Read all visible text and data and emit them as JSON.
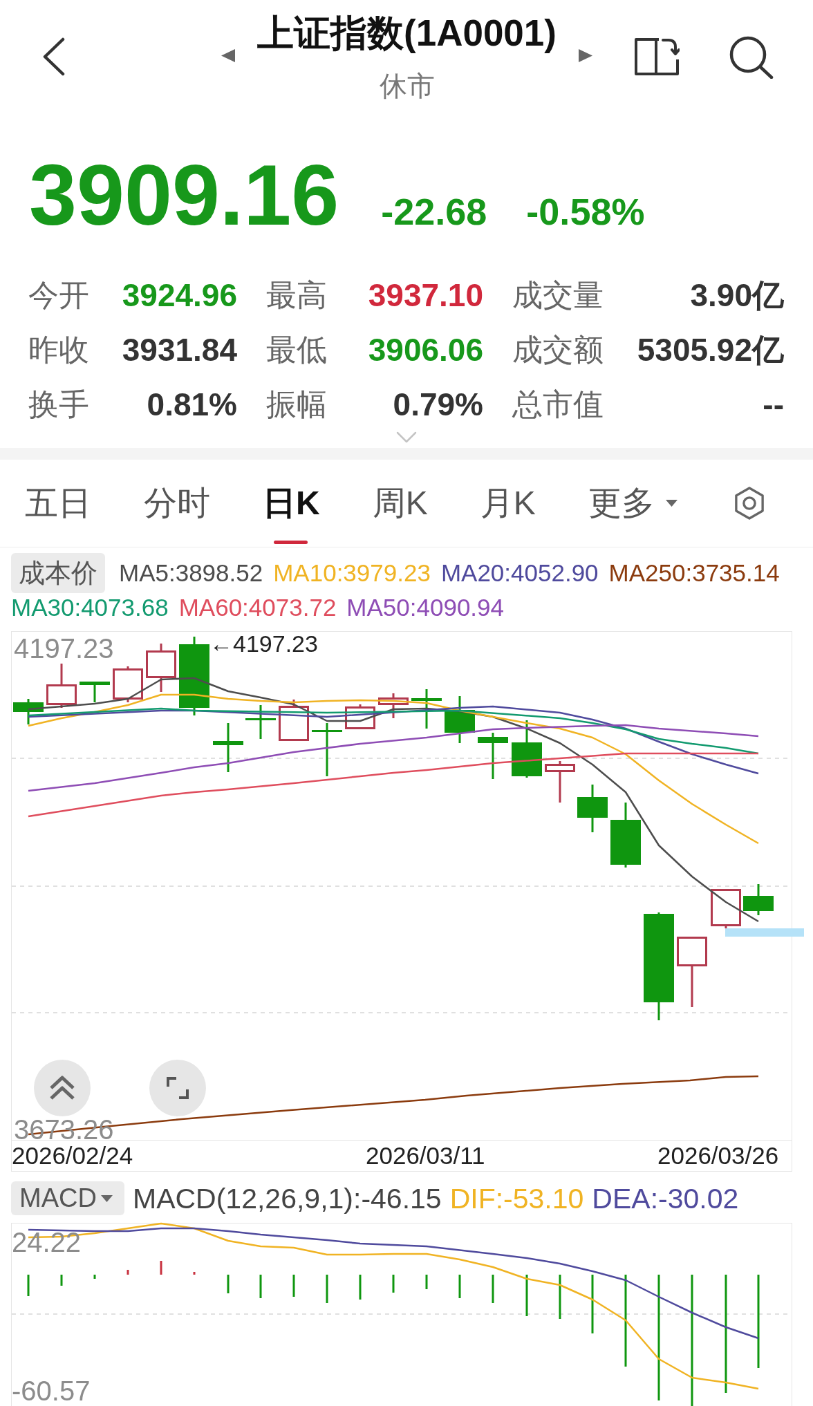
{
  "header": {
    "title": "上证指数(1A0001)",
    "status": "休市"
  },
  "quote": {
    "price": "3909.16",
    "change": "-22.68",
    "change_percent": "-0.58%",
    "rising": false
  },
  "stats": [
    {
      "label": "今开",
      "value": "3924.96",
      "color": "#17981b"
    },
    {
      "label": "最高",
      "value": "3937.10",
      "color": "#d1283c"
    },
    {
      "label": "成交量",
      "value": "3.90亿",
      "color": "#333333"
    },
    {
      "label": "昨收",
      "value": "3931.84",
      "color": "#333333"
    },
    {
      "label": "最低",
      "value": "3906.06",
      "color": "#17981b"
    },
    {
      "label": "成交额",
      "value": "5305.92亿",
      "color": "#333333"
    },
    {
      "label": "换手",
      "value": "0.81%",
      "color": "#333333"
    },
    {
      "label": "振幅",
      "value": "0.79%",
      "color": "#333333"
    },
    {
      "label": "总市值",
      "value": "--",
      "color": "#333333"
    }
  ],
  "tabs": [
    {
      "label": "五日",
      "kind": "period",
      "selected": false
    },
    {
      "label": "分时",
      "kind": "period",
      "selected": false
    },
    {
      "label": "日K",
      "kind": "period",
      "selected": true
    },
    {
      "label": "周K",
      "kind": "period",
      "selected": false
    },
    {
      "label": "月K",
      "kind": "period",
      "selected": false
    },
    {
      "label": "更多",
      "kind": "menu",
      "selected": false
    }
  ],
  "legend": {
    "cost_button": "成本价",
    "averages": [
      {
        "label": "MA5:3898.52",
        "color": "#4d4d4d"
      },
      {
        "label": "MA10:3979.23",
        "color": "#f0b323"
      },
      {
        "label": "MA20:4052.90",
        "color": "#4f4a9d"
      },
      {
        "label": "MA250:3735.14",
        "color": "#8b3b0e"
      },
      {
        "label": "MA30:4073.68",
        "color": "#129a6f"
      },
      {
        "label": "MA60:4073.72",
        "color": "#df4d5d"
      },
      {
        "label": "MA50:4090.94",
        "color": "#8e4db5"
      }
    ]
  },
  "kline_chart": {
    "high_label": "4197.23",
    "low_label": "3673.26",
    "peak_label": "←4197.23",
    "dates": [
      "2026/02/24",
      "2026/03/11",
      "2026/03/26"
    ]
  },
  "macd": {
    "selector": "MACD",
    "readings": [
      {
        "label": "MACD(12,26,9,1):-46.15",
        "color": "#444444"
      },
      {
        "label": "DIF:-53.10",
        "color": "#f0b323"
      },
      {
        "label": "DEA:-30.02",
        "color": "#4f4a9d"
      }
    ],
    "high_label": "24.22",
    "low_label": "-60.57"
  }
}
